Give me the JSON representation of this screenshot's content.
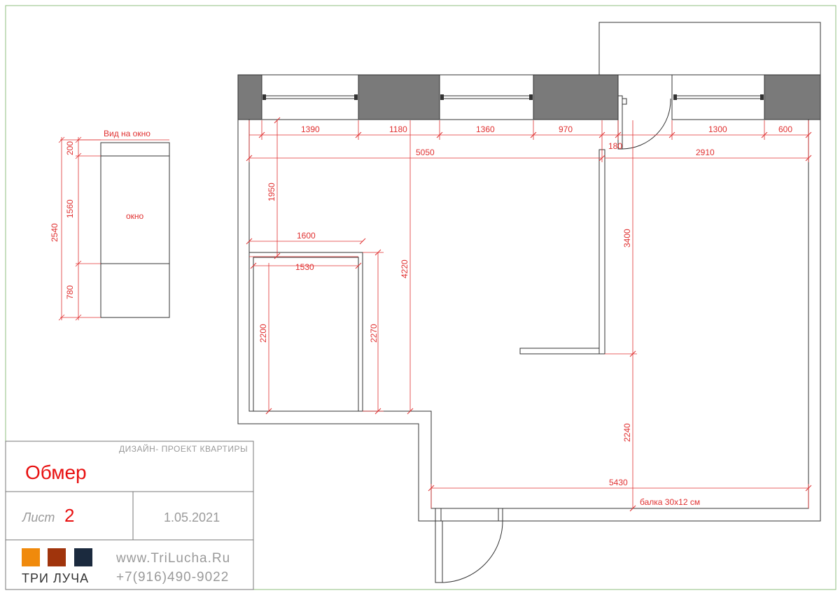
{
  "window_detail": {
    "title": "Вид на окно",
    "label": "окно",
    "dims": [
      "200",
      "1560",
      "780",
      "2540"
    ]
  },
  "plan": {
    "top_dims": [
      "1390",
      "1180",
      "1360",
      "970",
      "1300",
      "600"
    ],
    "overall_left": "5050",
    "overall_right": "2910",
    "door_gap": "180",
    "dim_1950": "1950",
    "dim_1600": "1600",
    "dim_1530": "1530",
    "dim_2200": "2200",
    "dim_2270": "2270",
    "dim_4220": "4220",
    "dim_3400": "3400",
    "dim_2240": "2240",
    "dim_5430": "5430",
    "beam_note": "балка 30х12 см"
  },
  "stamp": {
    "project": "ДИЗАЙН- ПРОЕКТ КВАРТИРЫ",
    "title": "Обмер",
    "sheet_label": "Лист",
    "sheet_number": "2",
    "date": "1.05.2021",
    "website": "www.TriLucha.Ru",
    "phone": "+7(916)490-9022",
    "brand": "ТРИ ЛУЧА"
  },
  "colors": {
    "dimension": "#e03030",
    "wall": "#7a7a7a",
    "swatch_orange": "#f08a0c",
    "swatch_rust": "#a0340c",
    "swatch_navy": "#1b2a3e",
    "title_red": "#e81010",
    "frame_green": "#8fbf7f"
  }
}
